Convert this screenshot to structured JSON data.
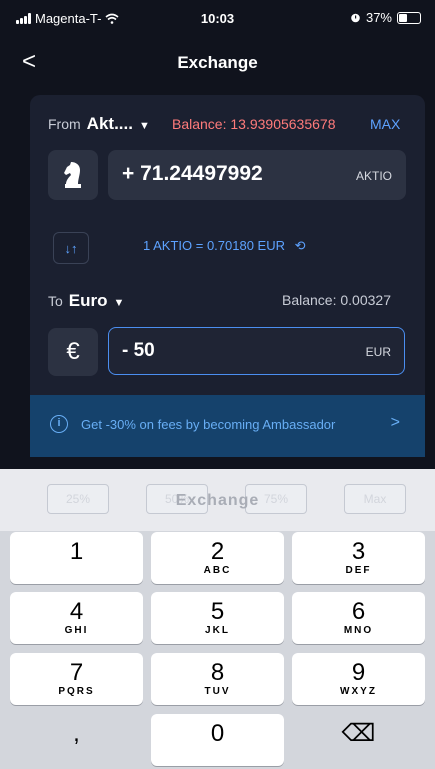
{
  "status_bar": {
    "carrier": "Magenta-T-",
    "time": "10:03",
    "battery": "37%"
  },
  "header": {
    "back": "<",
    "title": "Exchange"
  },
  "from": {
    "label": "From",
    "asset": "Akt....",
    "balance_text": "Balance: 13.93905635678",
    "max_label": "MAX",
    "amount": "+ 71.24497992",
    "currency": "AKTIO"
  },
  "rate": {
    "text": "1 AKTIO = 0.70180 EUR",
    "swap_icon": "↓↑",
    "refresh_icon": "⟲"
  },
  "to": {
    "label": "To",
    "asset": "Euro",
    "balance_text": "Balance: 0.00327",
    "symbol": "€",
    "amount": "- 50",
    "currency": "EUR"
  },
  "promo": {
    "text": "Get -30% on fees by becoming Ambassador",
    "arrow": ">"
  },
  "percent_chips": [
    "25%",
    "50%",
    "75%",
    "Max"
  ],
  "exchange_button": "Exchange",
  "keypad": [
    {
      "digit": "1",
      "letters": ""
    },
    {
      "digit": "2",
      "letters": "ABC"
    },
    {
      "digit": "3",
      "letters": "DEF"
    },
    {
      "digit": "4",
      "letters": "GHI"
    },
    {
      "digit": "5",
      "letters": "JKL"
    },
    {
      "digit": "6",
      "letters": "MNO"
    },
    {
      "digit": "7",
      "letters": "PQRS"
    },
    {
      "digit": "8",
      "letters": "TUV"
    },
    {
      "digit": "9",
      "letters": "WXYZ"
    },
    {
      "digit": ",",
      "letters": ""
    },
    {
      "digit": "0",
      "letters": ""
    },
    {
      "digit": "⌫",
      "letters": ""
    }
  ],
  "colors": {
    "background": "#10131d",
    "card": "#1b2030",
    "accent": "#5da2ff",
    "warning": "#ff7b7b",
    "promo": "#15426c"
  }
}
